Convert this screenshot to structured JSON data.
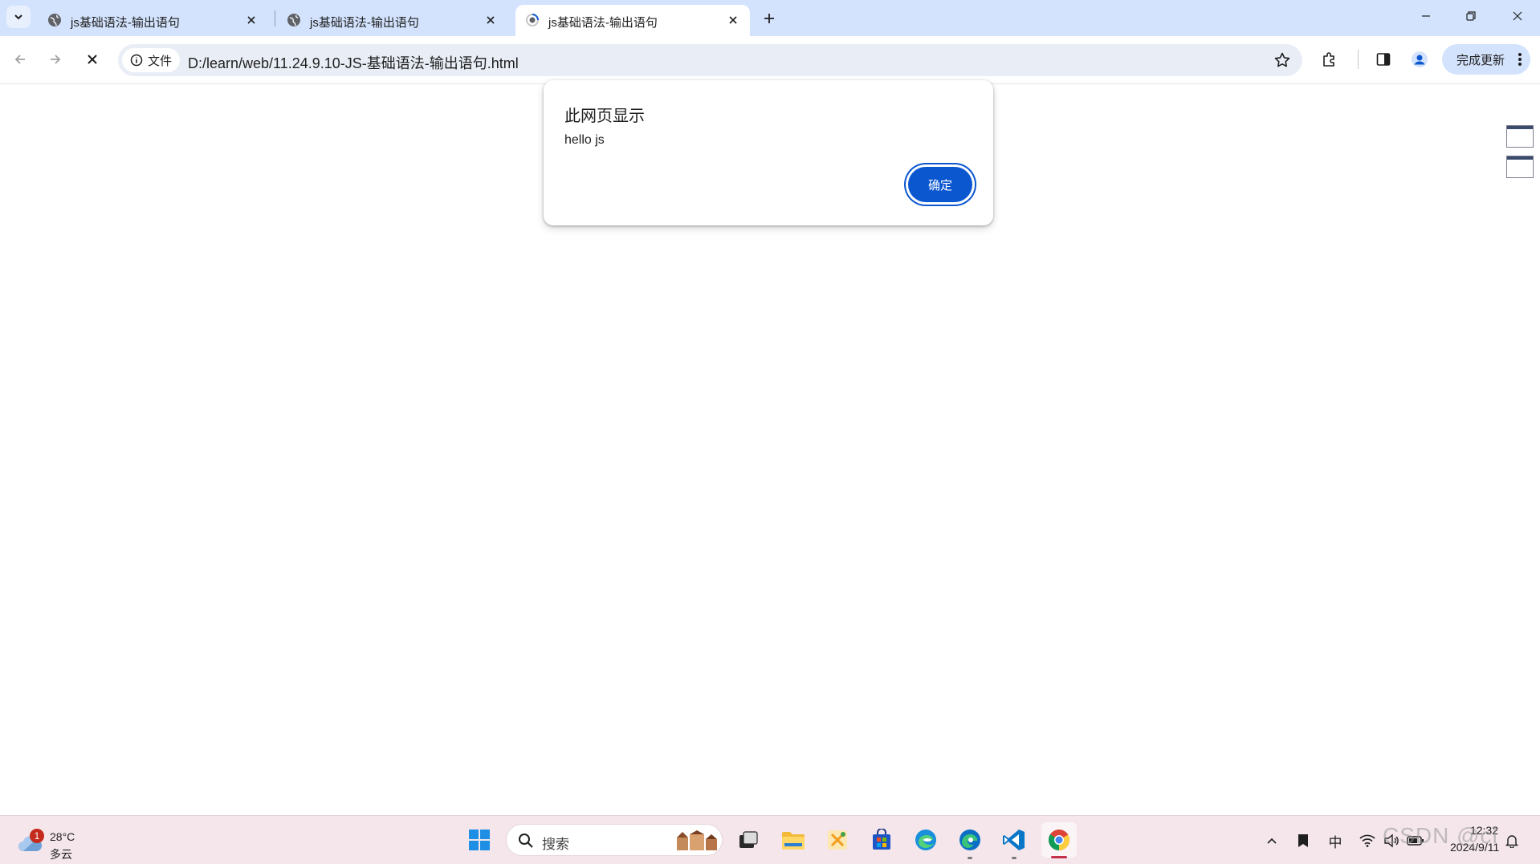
{
  "tabs": [
    {
      "title": "js基础语法-输出语句",
      "active": false
    },
    {
      "title": "js基础语法-输出语句",
      "active": false
    },
    {
      "title": "js基础语法-输出语句",
      "active": true
    }
  ],
  "address_bar": {
    "chip_label": "文件",
    "url": "D:/learn/web/11.24.9.10-JS-基础语法-输出语句.html"
  },
  "toolbar": {
    "update_label": "完成更新"
  },
  "dialog": {
    "title": "此网页显示",
    "message": "hello js",
    "ok_label": "确定"
  },
  "taskbar": {
    "weather_temp": "28°C",
    "weather_cond": "多云",
    "weather_badge": "1",
    "search_placeholder": "搜索",
    "ime_label": "中",
    "time": "12:32",
    "date": "2024/9/11",
    "apps": [
      "start-menu",
      "search",
      "task-view",
      "file-explorer",
      "app-tool",
      "microsoft-store",
      "edge",
      "edge-dev",
      "vscode",
      "chrome"
    ]
  },
  "watermark": "CSDN @cl",
  "colors": {
    "tabstrip": "#d3e3fd",
    "accent": "#0b57d0",
    "taskbar": "#f4e6ea"
  }
}
